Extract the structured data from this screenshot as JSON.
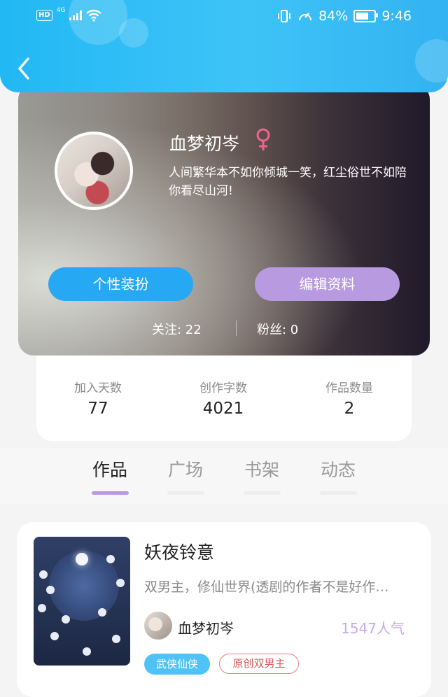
{
  "status_bar": {
    "hd": "HD",
    "network": "4G",
    "battery_level": 0.84,
    "battery_text": "84%",
    "time": "9:46"
  },
  "profile": {
    "name": "血梦初岑",
    "gender_symbol": "♀",
    "signature": "人间繁华本不如你倾城一笑，红尘俗世不如陪你看尽山河!",
    "buttons": {
      "dress": "个性装扮",
      "edit": "编辑资料"
    },
    "follow_label": "关注:  22",
    "fans_label": "粉丝:  0"
  },
  "stats": [
    {
      "label": "加入天数",
      "value": "77"
    },
    {
      "label": "创作字数",
      "value": "4021"
    },
    {
      "label": "作品数量",
      "value": "2"
    }
  ],
  "tabs": [
    "作品",
    "广场",
    "书架",
    "动态"
  ],
  "active_tab": 0,
  "book": {
    "title": "妖夜铃意",
    "desc": "双男主，修仙世界(透剧的作者不是好作…",
    "author": "血梦初岑",
    "popularity": "1547人气",
    "tags": [
      "武侠仙侠",
      "原创双男主"
    ]
  },
  "colors": {
    "header": "#22b8f4",
    "dress_button": "#27a8f3",
    "edit_button": "#b79ae0",
    "popularity": "#c9a9ea",
    "tag_primary": "#4fc3f7",
    "tag_outline": "#e08080"
  }
}
